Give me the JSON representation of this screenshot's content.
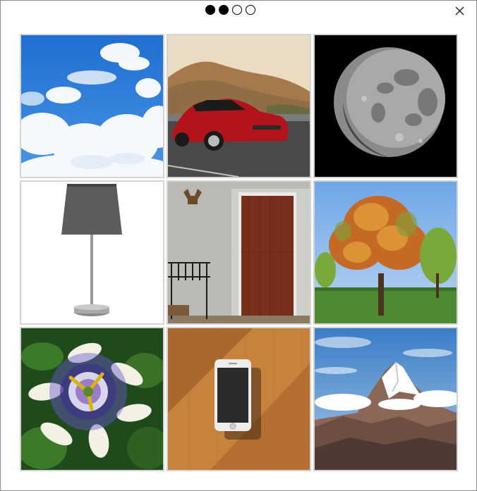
{
  "header": {
    "progress_steps": [
      {
        "state": "filled"
      },
      {
        "state": "filled"
      },
      {
        "state": "empty"
      },
      {
        "state": "empty"
      }
    ],
    "close_icon": "close-icon"
  },
  "grid": {
    "tiles": [
      {
        "name": "sky-clouds"
      },
      {
        "name": "red-car"
      },
      {
        "name": "moon"
      },
      {
        "name": "table-lamp"
      },
      {
        "name": "hallway-door"
      },
      {
        "name": "autumn-tree"
      },
      {
        "name": "passion-flower"
      },
      {
        "name": "smartphone"
      },
      {
        "name": "mountain-peak"
      }
    ]
  },
  "colors": {
    "border": "#8c8c8c",
    "tile_border": "#d4d4d4",
    "dot": "#000000"
  }
}
